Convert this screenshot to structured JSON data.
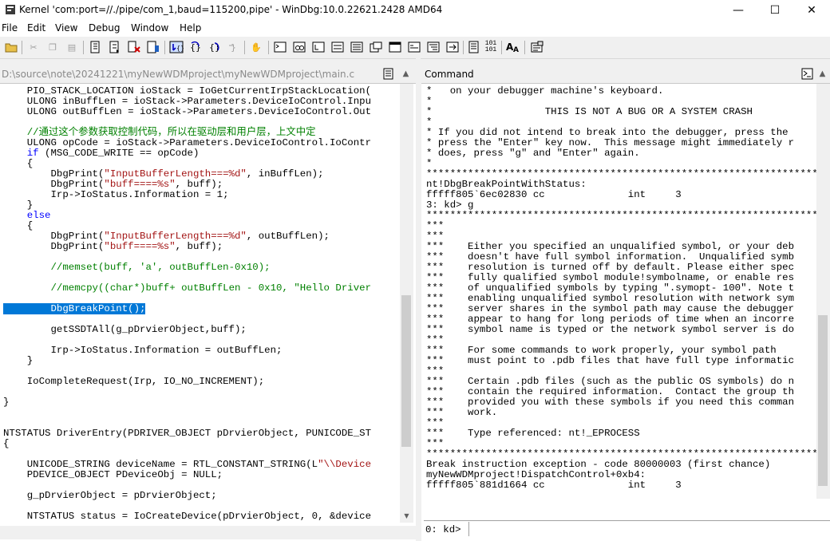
{
  "window": {
    "title": "Kernel 'com:port=//./pipe/com_1,baud=115200,pipe' - WinDbg:10.0.22621.2428 AMD64",
    "minimize": "—",
    "maximize": "☐",
    "close": "✕"
  },
  "menu": [
    "File",
    "Edit",
    "View",
    "Debug",
    "Window",
    "Help"
  ],
  "source_pane": {
    "path": "D:\\source\\note\\20241221\\myNewWDMproject\\myNewWDMproject\\main.c",
    "lines": [
      "    PIO_STACK_LOCATION ioStack = IoGetCurrentIrpStackLocation(",
      "    ULONG inBuffLen = ioStack->Parameters.DeviceIoControl.Inpu",
      "    ULONG outBuffLen = ioStack->Parameters.DeviceIoControl.Out",
      "",
      "    //通过这个参数获取控制代码，所以在驱动层和用户层，上文中定",
      "    ULONG opCode = ioStack->Parameters.DeviceIoControl.IoContr",
      "    if (MSG_CODE_WRITE == opCode)",
      "    {",
      "        DbgPrint(\"InputBufferLength===%d\", inBuffLen);",
      "        DbgPrint(\"buff====%s\", buff);",
      "        Irp->IoStatus.Information = 1;",
      "    }",
      "    else",
      "    {",
      "        DbgPrint(\"InputBufferLength===%d\", outBuffLen);",
      "        DbgPrint(\"buff====%s\", buff);",
      "",
      "        //memset(buff, 'a', outBuffLen-0x10);",
      "",
      "        //memcpy((char*)buff+ outBuffLen - 0x10, \"Hello Driver",
      "",
      "        DbgBreakPoint();",
      "",
      "        getSSDTAll(g_pDrvierObject,buff);",
      "",
      "        Irp->IoStatus.Information = outBuffLen;",
      "    }",
      "",
      "    IoCompleteRequest(Irp, IO_NO_INCREMENT);",
      "",
      "}",
      "",
      "",
      "NTSTATUS DriverEntry(PDRIVER_OBJECT pDrvierObject, PUNICODE_ST",
      "{",
      "",
      "    UNICODE_STRING deviceName = RTL_CONSTANT_STRING(L\"\\\\Device",
      "    PDEVICE_OBJECT PDeviceObj = NULL;",
      "",
      "    g_pDrvierObject = pDrvierObject;",
      "",
      "    NTSTATUS status = IoCreateDevice(pDrvierObject, 0, &device"
    ]
  },
  "command_pane": {
    "title": "Command",
    "lines": [
      "*   on your debugger machine's keyboard.",
      "*",
      "*                   THIS IS NOT A BUG OR A SYSTEM CRASH",
      "*",
      "* If you did not intend to break into the debugger, press the",
      "* press the \"Enter\" key now.  This message might immediately r",
      "* does, press \"g\" and \"Enter\" again.",
      "*",
      "*******************************************************************",
      "nt!DbgBreakPointWithStatus:",
      "fffff805`6ec02830 cc              int     3",
      "3: kd> g",
      "*******************************************************************",
      "***",
      "***",
      "***    Either you specified an unqualified symbol, or your deb",
      "***    doesn't have full symbol information.  Unqualified symb",
      "***    resolution is turned off by default. Please either spec",
      "***    fully qualified symbol module!symbolname, or enable res",
      "***    of unqualified symbols by typing \".symopt- 100\". Note t",
      "***    enabling unqualified symbol resolution with network sym",
      "***    server shares in the symbol path may cause the debugger",
      "***    appear to hang for long periods of time when an incorre",
      "***    symbol name is typed or the network symbol server is do",
      "***",
      "***    For some commands to work properly, your symbol path",
      "***    must point to .pdb files that have full type informatic",
      "***",
      "***    Certain .pdb files (such as the public OS symbols) do n",
      "***    contain the required information.  Contact the group th",
      "***    provided you with these symbols if you need this comman",
      "***    work.",
      "***",
      "***    Type referenced: nt!_EPROCESS",
      "***",
      "*******************************************************************",
      "Break instruction exception - code 80000003 (first chance)",
      "myNewWDMproject!DispatchControl+0xb4:",
      "fffff805`881d1664 cc              int     3"
    ],
    "prompt": "0: kd>",
    "input_value": ""
  },
  "colors": {
    "keyword": "#0000ff",
    "string": "#a31515",
    "comment": "#008000",
    "highlight": "#0078d7"
  }
}
